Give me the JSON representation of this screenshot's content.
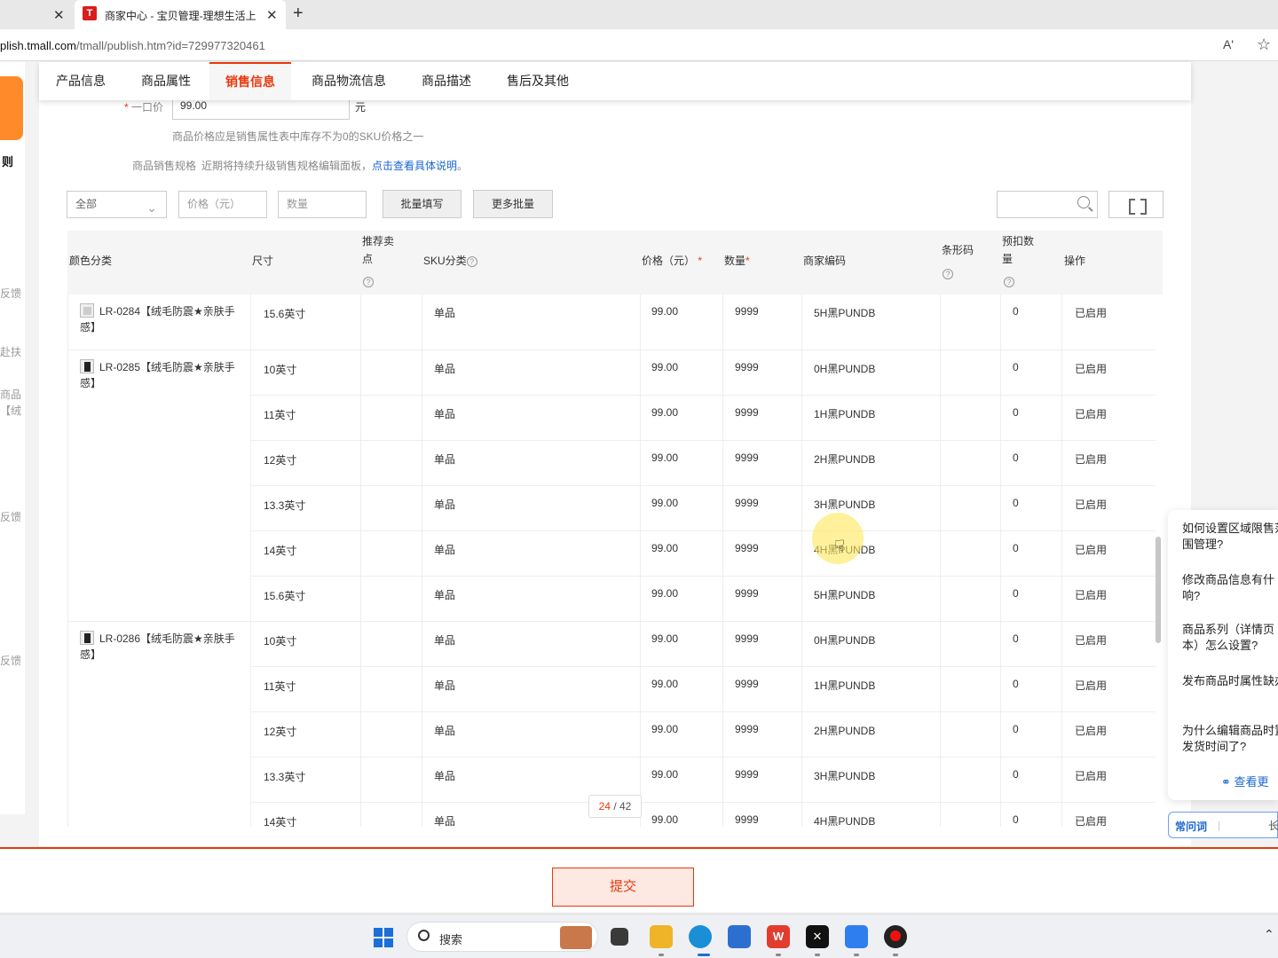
{
  "browser": {
    "active_tab_title": "商家中心 - 宝贝管理-理想生活上",
    "favicon_letter": "T",
    "url_domain": "plish.tmall.com",
    "url_path": "/tmall/publish.htm?id=729977320461",
    "close_symbol": "✕",
    "new_tab_symbol": "+",
    "read_aloud": "Aʹ",
    "favorite": "☆"
  },
  "left_sidebar": {
    "rules_label": "则",
    "fragments": [
      "反馈",
      "赴扶",
      "商品",
      "【绒",
      "反馈",
      "反馈"
    ]
  },
  "nav_tabs": [
    {
      "label": "产品信息",
      "active": false
    },
    {
      "label": "商品属性",
      "active": false
    },
    {
      "label": "销售信息",
      "active": true
    },
    {
      "label": "商品物流信息",
      "active": false
    },
    {
      "label": "商品描述",
      "active": false
    },
    {
      "label": "售后及其他",
      "active": false
    }
  ],
  "price": {
    "required_mark": "*",
    "label": "一口价",
    "value": "99.00",
    "unit": "元",
    "hint": "商品价格应是销售属性表中库存不为0的SKU价格之一"
  },
  "spec": {
    "label": "商品销售规格",
    "hint": "近期将持续升级销售规格编辑面板，",
    "link": "点击查看具体说明",
    "link_suffix": "。"
  },
  "toolbar": {
    "filter_all": "全部",
    "price_placeholder": "价格（元）",
    "qty_placeholder": "数量",
    "batch_fill": "批量填写",
    "more_batch": "更多批量"
  },
  "table": {
    "headers": {
      "color": "颜色分类",
      "size": "尺寸",
      "selling_point": "推荐卖点",
      "sku_type": "SKU分类",
      "price": "价格（元）",
      "qty": "数量",
      "code": "商家编码",
      "barcode": "条形码",
      "reserve": "预扣数量",
      "action": "操作"
    },
    "rows": [
      {
        "color": "LR-0284【绒毛防震★亲肤手感】",
        "size": "15.6英寸",
        "sku": "单品",
        "price": "99.00",
        "qty": "9999",
        "code": "5H黑PUNDB",
        "reserve": "0",
        "status": "已启用"
      },
      {
        "color": "LR-0285【绒毛防震★亲肤手感】",
        "size": "10英寸",
        "sku": "单品",
        "price": "99.00",
        "qty": "9999",
        "code": "0H黑PUNDB",
        "reserve": "0",
        "status": "已启用"
      },
      {
        "color": "",
        "size": "11英寸",
        "sku": "单品",
        "price": "99.00",
        "qty": "9999",
        "code": "1H黑PUNDB",
        "reserve": "0",
        "status": "已启用"
      },
      {
        "color": "",
        "size": "12英寸",
        "sku": "单品",
        "price": "99.00",
        "qty": "9999",
        "code": "2H黑PUNDB",
        "reserve": "0",
        "status": "已启用"
      },
      {
        "color": "",
        "size": "13.3英寸",
        "sku": "单品",
        "price": "99.00",
        "qty": "9999",
        "code": "3H黑PUNDB",
        "reserve": "0",
        "status": "已启用"
      },
      {
        "color": "",
        "size": "14英寸",
        "sku": "单品",
        "price": "99.00",
        "qty": "9999",
        "code": "4H黑PUNDB",
        "reserve": "0",
        "status": "已启用"
      },
      {
        "color": "",
        "size": "15.6英寸",
        "sku": "单品",
        "price": "99.00",
        "qty": "9999",
        "code": "5H黑PUNDB",
        "reserve": "0",
        "status": "已启用"
      },
      {
        "color": "LR-0286【绒毛防震★亲肤手感】",
        "size": "10英寸",
        "sku": "单品",
        "price": "99.00",
        "qty": "9999",
        "code": "0H黑PUNDB",
        "reserve": "0",
        "status": "已启用"
      },
      {
        "color": "",
        "size": "11英寸",
        "sku": "单品",
        "price": "99.00",
        "qty": "9999",
        "code": "1H黑PUNDB",
        "reserve": "0",
        "status": "已启用"
      },
      {
        "color": "",
        "size": "12英寸",
        "sku": "单品",
        "price": "99.00",
        "qty": "9999",
        "code": "2H黑PUNDB",
        "reserve": "0",
        "status": "已启用"
      },
      {
        "color": "",
        "size": "13.3英寸",
        "sku": "单品",
        "price": "99.00",
        "qty": "9999",
        "code": "3H黑PUNDB",
        "reserve": "0",
        "status": "已启用"
      },
      {
        "color": "",
        "size": "14英寸",
        "sku": "单品",
        "price": "99.00",
        "qty": "9999",
        "code": "4H黑PUNDB",
        "reserve": "0",
        "status": "已启用"
      }
    ]
  },
  "pagination": {
    "current": "24",
    "separator": " / ",
    "total": "42"
  },
  "submit_label": "提交",
  "faq": {
    "questions": [
      "如何设置区域限售范围管理?",
      "修改商品信息有什响?",
      "商品系列（详情页本）怎么设置?",
      "发布商品时属性缺办",
      "为什么编辑商品时置发货时间了?"
    ],
    "more": "查看更",
    "footer_label": "常问词",
    "footer_change": "长"
  },
  "taskbar": {
    "search_label": "搜索"
  },
  "colors": {
    "accent": "#e8380d",
    "link": "#1a66d2"
  }
}
